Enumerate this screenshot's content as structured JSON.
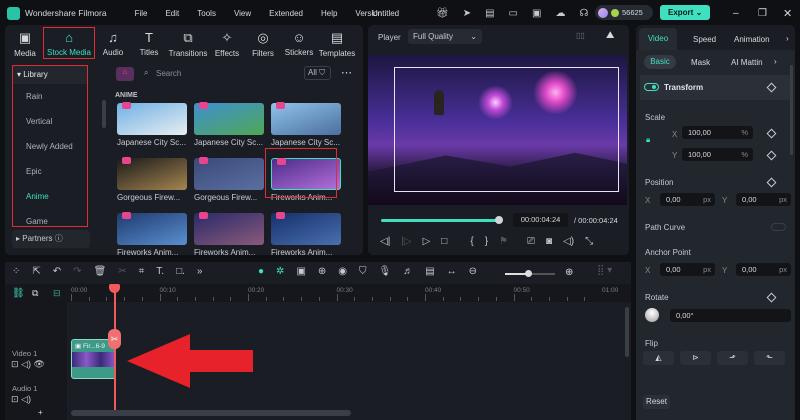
{
  "app": {
    "title": "Wondershare Filmora",
    "menu": [
      "File",
      "Edit",
      "Tools",
      "View",
      "Extended",
      "Help",
      "Version"
    ],
    "project": "Untitled",
    "credits": "56625",
    "export_label": "Export"
  },
  "toolbar": [
    {
      "label": "Media",
      "icon": "▣"
    },
    {
      "label": "Stock Media",
      "icon": "⌂"
    },
    {
      "label": "Audio",
      "icon": "♫"
    },
    {
      "label": "Titles",
      "icon": "T"
    },
    {
      "label": "Transitions",
      "icon": "⧉"
    },
    {
      "label": "Effects",
      "icon": "✧"
    },
    {
      "label": "Filters",
      "icon": "◎"
    },
    {
      "label": "Stickers",
      "icon": "☺"
    },
    {
      "label": "Templates",
      "icon": "▤"
    }
  ],
  "library": {
    "header": "Library",
    "items": [
      "Rain",
      "Vertical",
      "Newly Added",
      "Epic",
      "Anime",
      "Game"
    ],
    "active": "Anime",
    "partners": "Partners"
  },
  "browser": {
    "search_placeholder": "Search",
    "filter": "All",
    "section": "ANIME",
    "items": [
      {
        "title": "Japanese City Sc...",
        "c1": "#6fb0e6",
        "c2": "#e8eef0"
      },
      {
        "title": "Japanese City Sc...",
        "c1": "#3f8fd1",
        "c2": "#4fa855"
      },
      {
        "title": "Japanese City Sc...",
        "c1": "#8fc3ec",
        "c2": "#4b6f9e"
      },
      {
        "title": "Gorgeous Firew...",
        "c1": "#1a1a1a",
        "c2": "#a58550"
      },
      {
        "title": "Gorgeous Firew...",
        "c1": "#3a4a7a",
        "c2": "#5a6fa0"
      },
      {
        "title": "Fireworks Anim...",
        "c1": "#4a2d8a",
        "c2": "#b66fd8"
      },
      {
        "title": "Fireworks Anim...",
        "c1": "#1e3a6e",
        "c2": "#5a8fd0"
      },
      {
        "title": "Fireworks Anim...",
        "c1": "#2a2a6a",
        "c2": "#8a5a7a"
      },
      {
        "title": "Fireworks Anim...",
        "c1": "#15306a",
        "c2": "#4a6fb0"
      }
    ]
  },
  "player": {
    "label": "Player",
    "quality": "Full Quality",
    "current": "00:00:04:24",
    "total": "00:00:04:24",
    "progress": 1.0
  },
  "inspector": {
    "tabs": [
      "Video",
      "Speed",
      "Animation"
    ],
    "subtabs": [
      "Basic",
      "Mask",
      "AI Mattin"
    ],
    "transform": "Transform",
    "scale": "Scale",
    "scale_x": "100,00",
    "scale_y": "100,00",
    "pct": "%",
    "position": "Position",
    "pos_x": "0,00",
    "pos_y": "0,00",
    "px": "px",
    "path_curve": "Path Curve",
    "anchor": "Anchor Point",
    "anchor_x": "0,00",
    "anchor_y": "0,00",
    "rotate": "Rotate",
    "rotate_val": "0,00°",
    "flip": "Flip",
    "reset": "Reset",
    "x": "X",
    "y": "Y"
  },
  "timeline": {
    "ticks": [
      "00:00",
      "00:10",
      "00:20",
      "00:30",
      "00:40",
      "00:50",
      "01:00"
    ],
    "tracks": [
      "Video 1",
      "Audio 1"
    ],
    "clip": "Fir...6-9",
    "zoom": 0.45
  }
}
